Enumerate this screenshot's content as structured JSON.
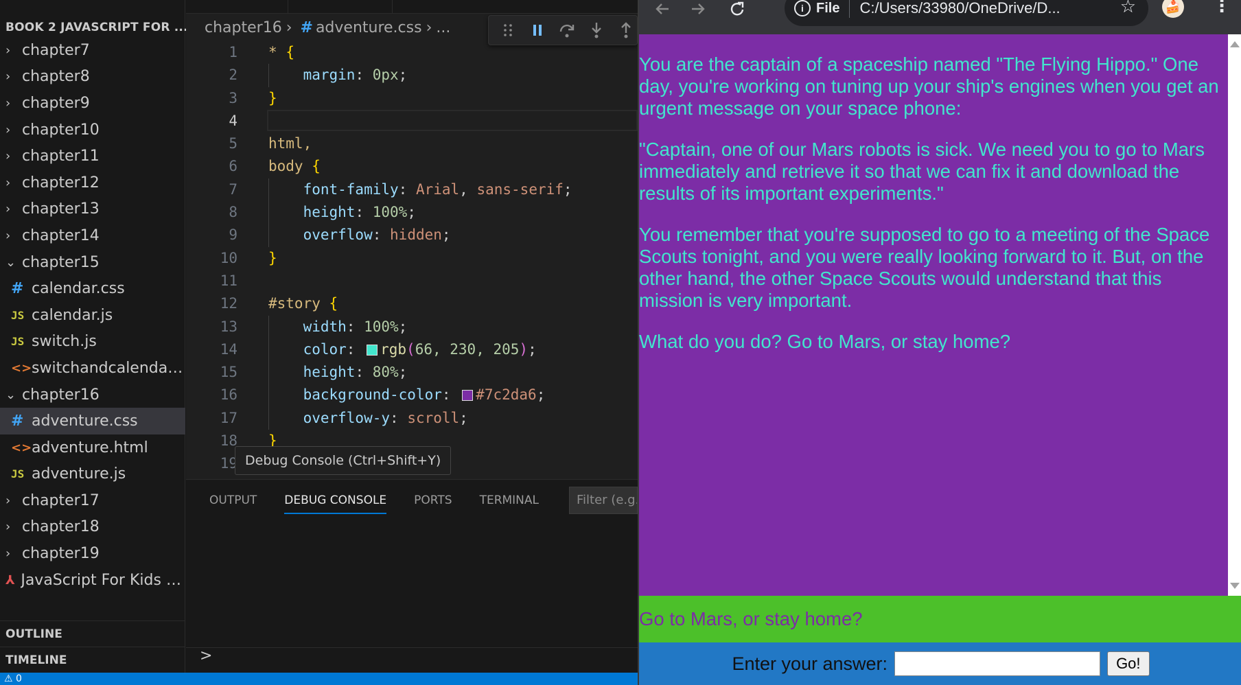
{
  "explorer": {
    "title": "BOOK 2 JAVASCRIPT FOR ...",
    "items": [
      {
        "type": "folder",
        "state": "collapsed",
        "label": "chapter7"
      },
      {
        "type": "folder",
        "state": "collapsed",
        "label": "chapter8"
      },
      {
        "type": "folder",
        "state": "collapsed",
        "label": "chapter9"
      },
      {
        "type": "folder",
        "state": "collapsed",
        "label": "chapter10"
      },
      {
        "type": "folder",
        "state": "collapsed",
        "label": "chapter11"
      },
      {
        "type": "folder",
        "state": "collapsed",
        "label": "chapter12"
      },
      {
        "type": "folder",
        "state": "collapsed",
        "label": "chapter13"
      },
      {
        "type": "folder",
        "state": "collapsed",
        "label": "chapter14"
      },
      {
        "type": "folder",
        "state": "expanded",
        "label": "chapter15"
      },
      {
        "type": "file",
        "icon": "css",
        "label": "calendar.css"
      },
      {
        "type": "file",
        "icon": "js",
        "label": "calendar.js"
      },
      {
        "type": "file",
        "icon": "js",
        "label": "switch.js"
      },
      {
        "type": "file",
        "icon": "html",
        "label": "switchandcalendar.h..."
      },
      {
        "type": "folder",
        "state": "expanded",
        "label": "chapter16"
      },
      {
        "type": "file",
        "icon": "css",
        "label": "adventure.css",
        "selected": true
      },
      {
        "type": "file",
        "icon": "html",
        "label": "adventure.html"
      },
      {
        "type": "file",
        "icon": "js",
        "label": "adventure.js"
      },
      {
        "type": "folder",
        "state": "collapsed",
        "label": "chapter17"
      },
      {
        "type": "folder",
        "state": "collapsed",
        "label": "chapter18"
      },
      {
        "type": "folder",
        "state": "collapsed",
        "label": "chapter19"
      },
      {
        "type": "pdf",
        "label": "JavaScript For Kids Fo..."
      }
    ],
    "outline_label": "OUTLINE",
    "timeline_label": "TIMELINE"
  },
  "editor": {
    "breadcrumb": {
      "folder": "chapter16",
      "file": "adventure.css",
      "more": "..."
    },
    "tooltip": "Debug Console (Ctrl+Shift+Y)",
    "current_line": 4,
    "line_numbers": [
      "1",
      "2",
      "3",
      "4",
      "5",
      "6",
      "7",
      "8",
      "9",
      "10",
      "11",
      "12",
      "13",
      "14",
      "15",
      "16",
      "17",
      "18",
      "19"
    ],
    "code": {
      "l1_sel": "*",
      "l1_brace": "{",
      "l2_prop": "margin",
      "l2_val": "0px",
      "l3_brace": "}",
      "l5_sel": "html,",
      "l6_sel": "body",
      "l6_brace": "{",
      "l7_prop": "font-family",
      "l7_val1": "Arial",
      "l7_val2": "sans-serif",
      "l8_prop": "height",
      "l8_val": "100%",
      "l9_prop": "overflow",
      "l9_val": "hidden",
      "l10_brace": "}",
      "l12_sel": "#story",
      "l12_brace": "{",
      "l13_prop": "width",
      "l13_val": "100%",
      "l14_prop": "color",
      "l14_fn": "rgb",
      "l14_args": "66, 230, 205",
      "l14_swatch": "#42e6cd",
      "l15_prop": "height",
      "l15_val": "80%",
      "l16_prop": "background-color",
      "l16_val": "#7c2da6",
      "l16_swatch": "#7c2da6",
      "l17_prop": "overflow-y",
      "l17_val": "scroll",
      "l18_brace": "}"
    }
  },
  "panel": {
    "tabs": [
      "OUTPUT",
      "DEBUG CONSOLE",
      "PORTS",
      "TERMINAL"
    ],
    "active_tab": "DEBUG CONSOLE",
    "filter_placeholder": "Filter (e.g.",
    "prompt": ">"
  },
  "statusbar": {
    "text": "⚠ 0"
  },
  "browser": {
    "scheme": "File",
    "url": "C:/Users/33980/OneDrive/D...",
    "story": [
      "You are the captain of a spaceship named \"The Flying Hippo.\" One day, you're working on tuning up your ship's engines when you get an urgent message on your space phone:",
      "\"Captain, one of our Mars robots is sick. We need you to go to Mars immediately and retrieve it so that we can fix it and download the results of its important experiments.\"",
      "You remember that you're supposed to go to a meeting of the Space Scouts tonight, and you were really looking forward to it. But, on the other hand, the other Space Scouts would understand that this mission is very important.",
      "What do you do? Go to Mars, or stay home?"
    ],
    "question": "Go to Mars, or stay home?",
    "answer_label": "Enter your answer:",
    "answer_value": "",
    "go_label": "Go!"
  },
  "colors": {
    "story_bg": "#7c2da6",
    "story_text": "rgb(66, 230, 205)",
    "question_bg": "#4cc02a",
    "answer_bg": "#2278c5",
    "vscode_accent": "#0078d4"
  }
}
